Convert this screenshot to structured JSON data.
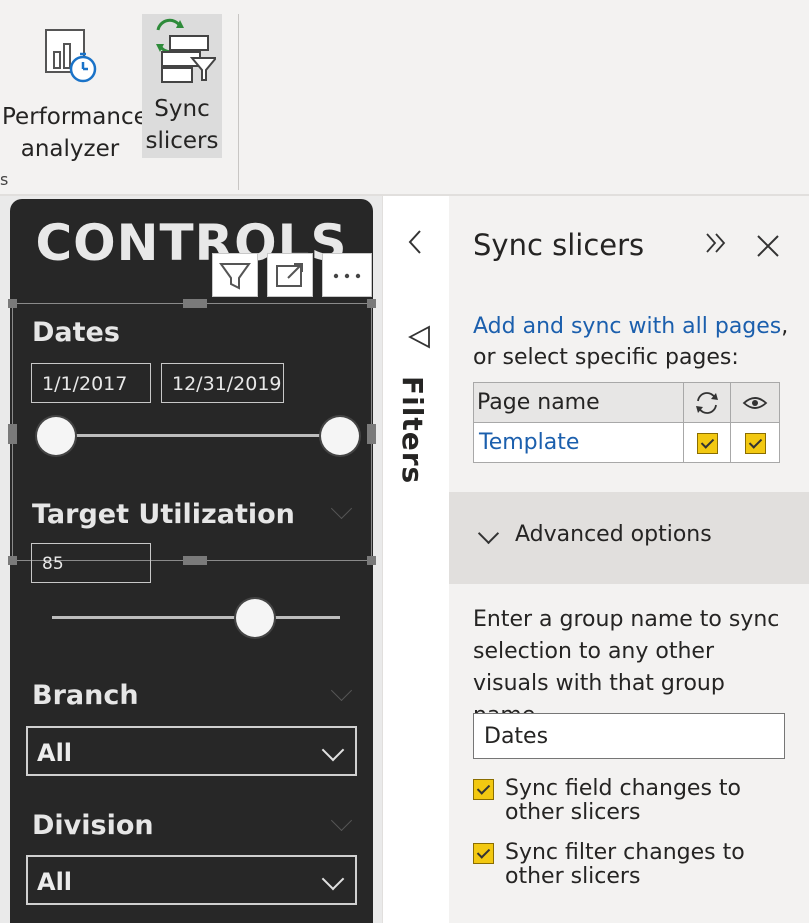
{
  "ribbon": {
    "performance_line1": "Performance",
    "performance_line2": "analyzer",
    "sync_line1": "Sync",
    "sync_line2": "slicers",
    "group_fragment": "s"
  },
  "controls": {
    "title": "CONTROLS",
    "dates": {
      "label": "Dates",
      "start": "1/1/2017",
      "end": "12/31/2019"
    },
    "target": {
      "label": "Target Utilization",
      "value": "85",
      "level": 0.85
    },
    "branch": {
      "label": "Branch",
      "selected": "All"
    },
    "division": {
      "label": "Division",
      "selected": "All"
    }
  },
  "filters_pane": {
    "label": "Filters"
  },
  "sync_panel": {
    "title": "Sync slicers",
    "link_text": "Add and sync with all pages",
    "comma": ",",
    "info_text": "or select specific pages:",
    "col_page_name": "Page name",
    "rows": [
      {
        "name": "Template",
        "sync": true,
        "visible": true
      }
    ],
    "advanced_label": "Advanced options",
    "group_description": "Enter a group name to sync selection to any other visuals with that group name",
    "group_name_value": "Dates",
    "option_field": "Sync field changes to other slicers",
    "option_filter": "Sync filter changes to other slicers"
  },
  "colors": {
    "accent_checkbox": "#f2c811",
    "link": "#1b5fad",
    "controls_bg": "#272727"
  }
}
